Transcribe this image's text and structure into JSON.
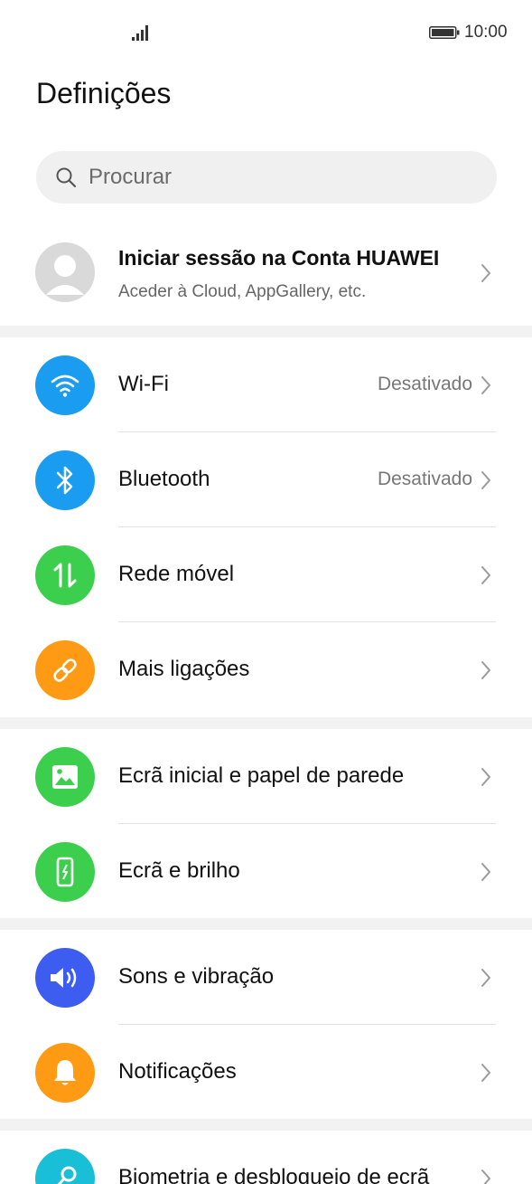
{
  "status_bar": {
    "time": "10:00"
  },
  "header": {
    "title": "Definições"
  },
  "search": {
    "placeholder": "Procurar"
  },
  "account": {
    "title": "Iniciar sessão na Conta HUAWEI",
    "subtitle": "Aceder à Cloud, AppGallery, etc."
  },
  "settings": {
    "wifi": {
      "label": "Wi-Fi",
      "value": "Desativado",
      "icon": "wifi-icon",
      "color": "#1a9cf0"
    },
    "bluetooth": {
      "label": "Bluetooth",
      "value": "Desativado",
      "icon": "bluetooth-icon",
      "color": "#1a9cf0"
    },
    "mobile_network": {
      "label": "Rede móvel",
      "icon": "mobile-data-icon",
      "color": "#3ccf4e"
    },
    "more_connections": {
      "label": "Mais ligações",
      "icon": "link-icon",
      "color": "#ff9a14"
    },
    "home_wallpaper": {
      "label": "Ecrã inicial e papel de parede",
      "icon": "image-icon",
      "color": "#3ccf4e"
    },
    "display": {
      "label": "Ecrã e brilho",
      "icon": "phone-brightness-icon",
      "color": "#3ccf4e"
    },
    "sounds": {
      "label": "Sons e vibração",
      "icon": "speaker-icon",
      "color": "#3d5cf0"
    },
    "notifications": {
      "label": "Notificações",
      "icon": "bell-icon",
      "color": "#ff9a14"
    },
    "biometrics": {
      "label": "Biometria e desbloqueio de ecrã",
      "icon": "key-icon",
      "color": "#18bfd6"
    }
  }
}
